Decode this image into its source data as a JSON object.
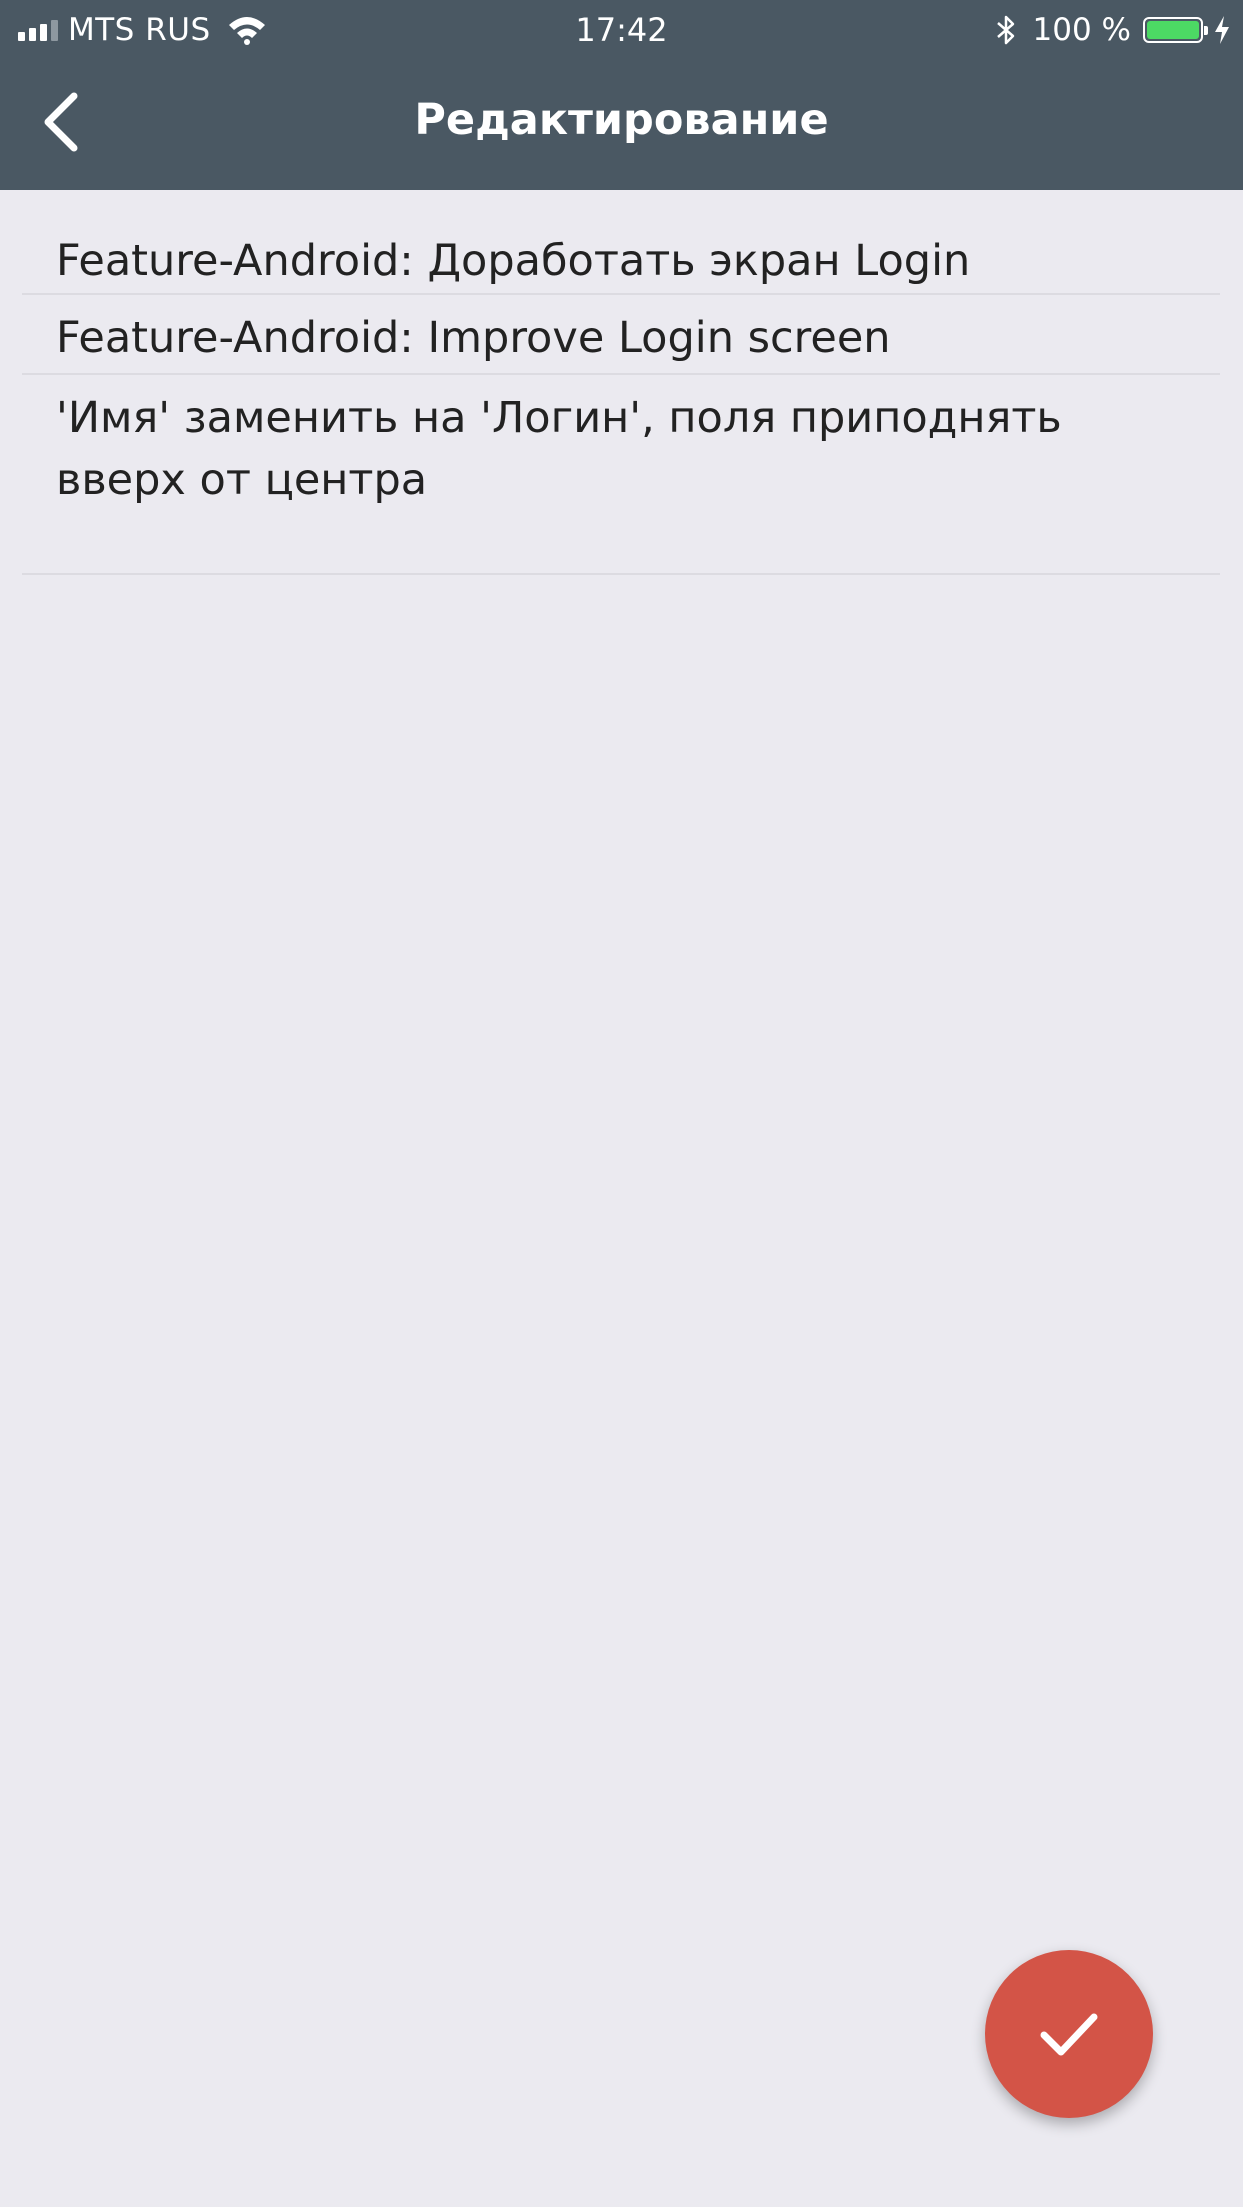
{
  "status_bar": {
    "carrier": "MTS RUS",
    "time": "17:42",
    "battery_percent": "100 %",
    "signal_bars_filled": 3,
    "signal_bars_total": 4
  },
  "nav": {
    "title": "Редактирование",
    "back_icon": "chevron-left-icon"
  },
  "fields": {
    "title_ru": "Feature-Android: Доработать экран Login",
    "title_en": "Feature-Android: Improve Login screen",
    "description": "'Имя' заменить на 'Логин', поля приподнять вверх от центра"
  },
  "fab": {
    "icon": "checkmark-icon"
  },
  "colors": {
    "header": "#4a5863",
    "background": "#ebeaf0",
    "fab": "#d35447",
    "battery": "#4cd964",
    "text": "#222222"
  }
}
